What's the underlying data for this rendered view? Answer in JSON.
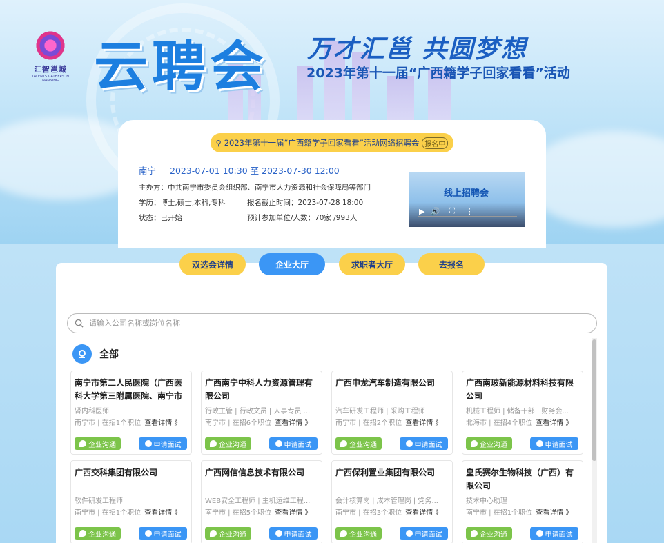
{
  "banner": {
    "logo_cn": "汇智邕城",
    "logo_en": "TALENTS GATHERS IN NANNING",
    "big_title": "云聘会",
    "slogan": "万才汇邕 共圆梦想",
    "subtitle": "2023年第十一届“广西籍学子回家看看”活动"
  },
  "info": {
    "event_title": "2023年第十一届“广西籍学子回家看看”活动网络招聘会",
    "badge": "报名中",
    "city": "南宁",
    "datetime": "2023-07-01 10:30 至 2023-07-30 12:00",
    "organizer_label": "主办方：",
    "organizer": "中共南宁市委员会组织部、南宁市人力资源和社会保障局等部门",
    "education_label": "学历：",
    "education": "博士,硕士,本科,专科",
    "deadline_label": "报名截止时间：",
    "deadline": "2023-07-28 18:00",
    "status_label": "状态：",
    "status": "已开始",
    "expected_label": "预计参加单位/人数：",
    "expected": "70家 /993人",
    "video_title": "线上招聘会"
  },
  "tabs": [
    {
      "label": "双选会详情",
      "active": false
    },
    {
      "label": "企业大厅",
      "active": true
    },
    {
      "label": "求职者大厅",
      "active": false
    },
    {
      "label": "去报名",
      "active": false
    }
  ],
  "search": {
    "placeholder": "请输入公司名称或岗位名称"
  },
  "category": {
    "label": "全部"
  },
  "cards": [
    {
      "name": "南宁市第二人民医院（广西医科大学第三附属医院、南宁市",
      "jobs": "肾内科医师",
      "city": "南宁市",
      "count": "在招1个职位"
    },
    {
      "name": "广西南宁中科人力资源管理有限公司",
      "jobs": "行政主管 | 行政文员 | 人事专员 ...",
      "city": "南宁市",
      "count": "在招6个职位"
    },
    {
      "name": "广西申龙汽车制造有限公司",
      "jobs": "汽车研发工程师 | 采购工程师",
      "city": "南宁市",
      "count": "在招2个职位"
    },
    {
      "name": "广西南玻新能源材料科技有限公司",
      "jobs": "机械工程师 | 储备干部 | 财务会...",
      "city": "北海市",
      "count": "在招4个职位"
    },
    {
      "name": "广西交科集团有限公司",
      "jobs": "软件研发工程师",
      "city": "南宁市",
      "count": "在招1个职位"
    },
    {
      "name": "广西网信信息技术有限公司",
      "jobs": "WEB安全工程师 | 主机运维工程...",
      "city": "南宁市",
      "count": "在招5个职位"
    },
    {
      "name": "广西保利置业集团有限公司",
      "jobs": "会计核算岗 | 成本管理岗 | 党务...",
      "city": "南宁市",
      "count": "在招3个职位"
    },
    {
      "name": "皇氏赛尔生物科技（广西）有限公司",
      "jobs": "技术中心助理",
      "city": "南宁市",
      "count": "在招1个职位"
    }
  ],
  "card_labels": {
    "more": "查看详情 》",
    "chat": "企业沟通",
    "apply": "申请面试",
    "sep": " | "
  }
}
